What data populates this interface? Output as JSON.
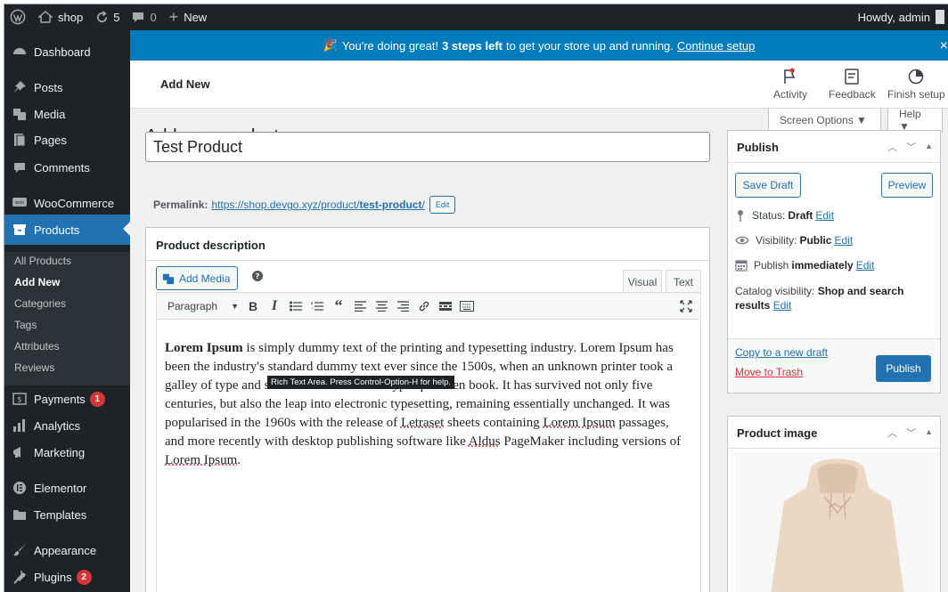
{
  "adminbar": {
    "site_name": "shop",
    "updates_count": "5",
    "comments_count": "0",
    "new_label": "New",
    "howdy": "Howdy, admin"
  },
  "sidebar": {
    "dashboard": "Dashboard",
    "posts": "Posts",
    "media": "Media",
    "pages": "Pages",
    "comments": "Comments",
    "woocommerce": "WooCommerce",
    "products": "Products",
    "submenu": [
      "All Products",
      "Add New",
      "Categories",
      "Tags",
      "Attributes",
      "Reviews"
    ],
    "payments": "Payments",
    "payments_badge": "1",
    "analytics": "Analytics",
    "marketing": "Marketing",
    "elementor": "Elementor",
    "templates": "Templates",
    "appearance": "Appearance",
    "plugins": "Plugins",
    "plugins_badge": "2"
  },
  "notice": {
    "text_before": "You're doing great!",
    "text_bold": "3 steps left",
    "text_after": "to get your store up and running.",
    "link": "Continue setup",
    "close": "×"
  },
  "header": {
    "title": "Add New",
    "activity": "Activity",
    "feedback": "Feedback",
    "finish_setup": "Finish setup"
  },
  "screen": {
    "screen_options": "Screen Options ▼",
    "help": "Help ▼"
  },
  "page": {
    "title": "Add new product",
    "product_title_value": "Test Product",
    "permalink_label": "Permalink:",
    "permalink_base": "https://shop.devgo.xyz/product/",
    "permalink_slug": "test-product",
    "permalink_tail": "/",
    "permalink_edit": "Edit"
  },
  "description": {
    "title": "Product description",
    "add_media": "Add Media",
    "help": "?",
    "tab_visual": "Visual",
    "tab_text": "Text",
    "format": "Paragraph",
    "tooltip": "Rich Text Area. Press Control-Option-H for help.",
    "content_bold": "Lorem Ipsum",
    "content_1": " is simply dummy text of the printing and typesetting industry. Lorem Ipsum has been the industry's standard dummy text ever since the 1500s, when an unknown printer took a galley of type and scrambled it to make a type specimen book. It has survived not only five centuries, but also the leap into electronic typesetting, remaining essentially unchanged. It was popularised in the 1960s with the release of ",
    "spell_1": "Letraset",
    "content_2": " sheets containing ",
    "spell_2": "Lorem Ipsum",
    "content_3": " passages, and more recently with desktop publishing software like ",
    "spell_3": "Aldus",
    "content_4": " PageMaker including versions of ",
    "spell_4": "Lorem Ipsum",
    "content_5": "."
  },
  "publish": {
    "title": "Publish",
    "save_draft": "Save Draft",
    "preview": "Preview",
    "status_label": "Status:",
    "status_value": "Draft",
    "visibility_label": "Visibility:",
    "visibility_value": "Public",
    "publish_label": "Publish",
    "publish_value": "immediately",
    "edit": "Edit",
    "catalog_label": "Catalog visibility:",
    "catalog_value": "Shop and search results",
    "copy_draft": "Copy to a new draft",
    "trash": "Move to Trash",
    "publish_button": "Publish"
  },
  "product_image": {
    "title": "Product image"
  },
  "colors": {
    "admin_dark": "#1d2327",
    "wp_blue": "#2271b1",
    "notice_blue": "#007cba",
    "badge_red": "#d63638"
  }
}
